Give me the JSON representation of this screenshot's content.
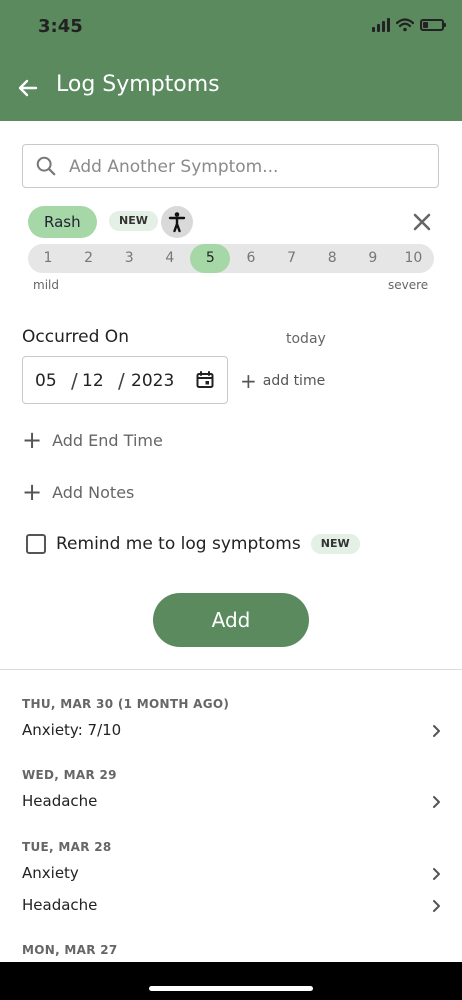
{
  "status_bar": {
    "time": "3:45"
  },
  "header": {
    "title": "Log Symptoms"
  },
  "search": {
    "placeholder": "Add Another Symptom..."
  },
  "symptom": {
    "name": "Rash",
    "new_badge": "NEW",
    "severity_levels": [
      "1",
      "2",
      "3",
      "4",
      "5",
      "6",
      "7",
      "8",
      "9",
      "10"
    ],
    "selected_severity": 5,
    "mild_label": "mild",
    "severe_label": "severe"
  },
  "occurred": {
    "label": "Occurred On",
    "today_label": "today",
    "month": "05",
    "day": "12",
    "year": "2023",
    "add_time_label": "add time"
  },
  "actions": {
    "add_end_time": "Add End Time",
    "add_notes": "Add Notes"
  },
  "reminder": {
    "label": "Remind me to log symptoms",
    "badge": "NEW",
    "checked": false
  },
  "add_button": "Add",
  "history": [
    {
      "date": "THU, MAR 30 (1 MONTH AGO)",
      "items": [
        "Anxiety: 7/10"
      ]
    },
    {
      "date": "WED, MAR 29",
      "items": [
        "Headache"
      ]
    },
    {
      "date": "TUE, MAR 28",
      "items": [
        "Anxiety",
        "Headache"
      ]
    },
    {
      "date": "MON, MAR 27",
      "items": []
    }
  ],
  "colors": {
    "primary": "#5a8a5e",
    "chip": "#a6d8a7",
    "badge_bg": "#e4efe5"
  }
}
